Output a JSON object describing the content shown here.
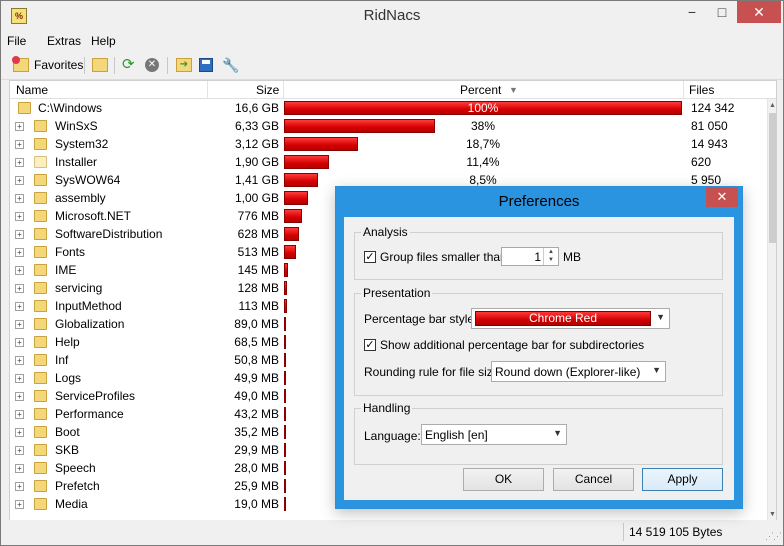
{
  "window": {
    "title": "RidNacs",
    "minimize": "−",
    "maximize": "□",
    "close": "✕"
  },
  "menu": [
    "File",
    "Extras",
    "Help"
  ],
  "toolbar": {
    "favorites_label": "Favorites"
  },
  "columns": {
    "name": "Name",
    "size": "Size",
    "percent": "Percent",
    "sort_indicator": "▼",
    "files": "Files"
  },
  "rows": [
    {
      "name": "C:\\Windows",
      "size": "16,6 GB",
      "percent_text": "100%",
      "percent": 100,
      "files": "124 342",
      "root": true
    },
    {
      "name": "WinSxS",
      "size": "6,33 GB",
      "percent_text": "38%",
      "percent": 38,
      "files": "81 050"
    },
    {
      "name": "System32",
      "size": "3,12 GB",
      "percent_text": "18,7%",
      "percent": 18.7,
      "files": "14 943"
    },
    {
      "name": "Installer",
      "size": "1,90 GB",
      "percent_text": "11,4%",
      "percent": 11.4,
      "files": "620",
      "light": true
    },
    {
      "name": "SysWOW64",
      "size": "1,41 GB",
      "percent_text": "8,5%",
      "percent": 8.5,
      "files": "5 950"
    },
    {
      "name": "assembly",
      "size": "1,00 GB",
      "percent_text": "",
      "percent": 6.0,
      "files": ""
    },
    {
      "name": "Microsoft.NET",
      "size": "776 MB",
      "percent_text": "",
      "percent": 4.6,
      "files": ""
    },
    {
      "name": "SoftwareDistribution",
      "size": "628 MB",
      "percent_text": "",
      "percent": 3.7,
      "files": ""
    },
    {
      "name": "Fonts",
      "size": "513 MB",
      "percent_text": "",
      "percent": 3.0,
      "files": ""
    },
    {
      "name": "IME",
      "size": "145 MB",
      "percent_text": "",
      "percent": 0.9,
      "files": ""
    },
    {
      "name": "servicing",
      "size": "128 MB",
      "percent_text": "",
      "percent": 0.8,
      "files": ""
    },
    {
      "name": "InputMethod",
      "size": "113 MB",
      "percent_text": "",
      "percent": 0.7,
      "files": ""
    },
    {
      "name": "Globalization",
      "size": "89,0 MB",
      "percent_text": "",
      "percent": 0.5,
      "files": ""
    },
    {
      "name": "Help",
      "size": "68,5 MB",
      "percent_text": "",
      "percent": 0.4,
      "files": ""
    },
    {
      "name": "Inf",
      "size": "50,8 MB",
      "percent_text": "",
      "percent": 0.3,
      "files": ""
    },
    {
      "name": "Logs",
      "size": "49,9 MB",
      "percent_text": "",
      "percent": 0.3,
      "files": ""
    },
    {
      "name": "ServiceProfiles",
      "size": "49,0 MB",
      "percent_text": "",
      "percent": 0.3,
      "files": ""
    },
    {
      "name": "Performance",
      "size": "43,2 MB",
      "percent_text": "",
      "percent": 0.25,
      "files": ""
    },
    {
      "name": "Boot",
      "size": "35,2 MB",
      "percent_text": "",
      "percent": 0.2,
      "files": ""
    },
    {
      "name": "SKB",
      "size": "29,9 MB",
      "percent_text": "",
      "percent": 0.2,
      "files": ""
    },
    {
      "name": "Speech",
      "size": "28,0 MB",
      "percent_text": "",
      "percent": 0.2,
      "files": ""
    },
    {
      "name": "Prefetch",
      "size": "25,9 MB",
      "percent_text": "",
      "percent": 0.15,
      "files": ""
    },
    {
      "name": "Media",
      "size": "19,0 MB",
      "percent_text": "",
      "percent": 0.1,
      "files": ""
    }
  ],
  "status": {
    "total": "14 519 105 Bytes"
  },
  "dialog": {
    "title": "Preferences",
    "close": "✕",
    "analysis": {
      "label": "Analysis",
      "group_label": "Group files smaller than:",
      "group_checked": true,
      "group_value": "1",
      "group_unit": "MB"
    },
    "presentation": {
      "label": "Presentation",
      "bar_style_label": "Percentage bar style:",
      "bar_style_value": "Chrome Red",
      "subdir_label": "Show additional percentage bar for subdirectories",
      "subdir_checked": true,
      "rounding_label": "Rounding rule for file size:",
      "rounding_value": "Round down (Explorer-like)"
    },
    "handling": {
      "label": "Handling",
      "language_label": "Language:",
      "language_value": "English [en]"
    },
    "buttons": {
      "ok": "OK",
      "cancel": "Cancel",
      "apply": "Apply"
    }
  },
  "colors": {
    "bar_red": "#d40000",
    "dialog_border": "#2b94e0",
    "close_red": "#c75050"
  }
}
